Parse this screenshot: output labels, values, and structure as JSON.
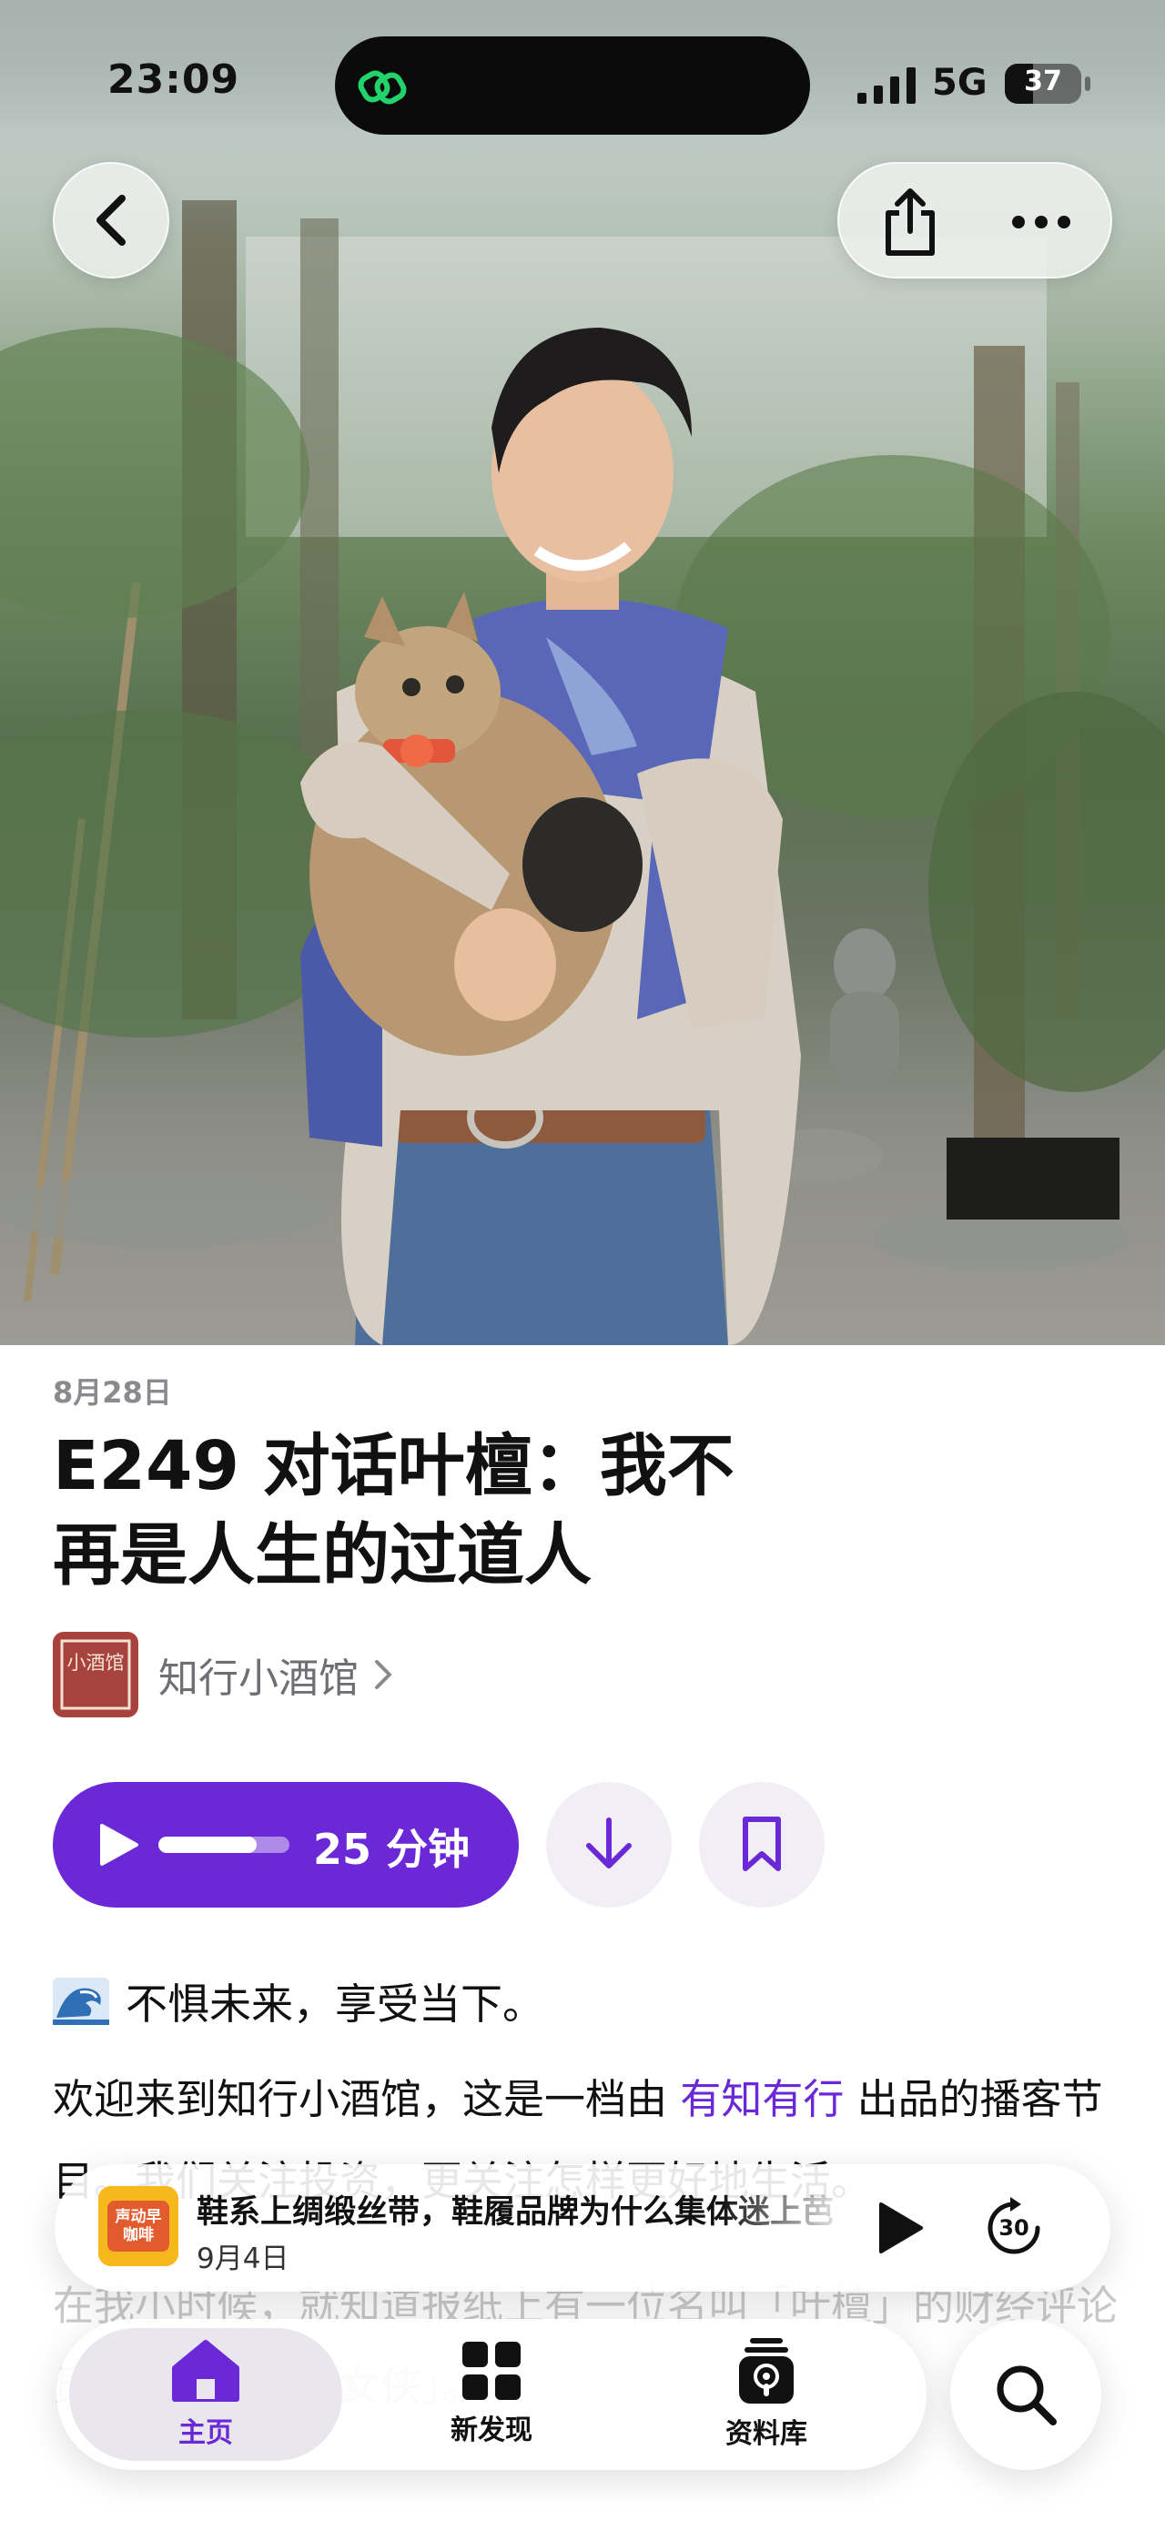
{
  "status_bar": {
    "time": "23:09",
    "network": "5G",
    "battery_percent": "37",
    "battery_level": 0.37
  },
  "colors": {
    "accent": "#6a28d6",
    "accent_light": "#f1eff5",
    "show_art": "#a8423c",
    "mini_art": "#f6b81c"
  },
  "icons": {
    "island": "link-icon",
    "back": "chevron-left-icon",
    "share": "share-icon",
    "more": "more-icon",
    "play": "play-icon",
    "download": "download-icon",
    "bookmark": "bookmark-icon",
    "wave": "wave-emoji-icon",
    "skip": "skip-forward-30-icon",
    "home": "home-icon",
    "discover": "grid-icon",
    "library": "podcast-library-icon",
    "search": "search-icon"
  },
  "episode": {
    "date": "8月28日",
    "title": "E249 对话叶檀：我不再是人生的过道人",
    "show_name": "知行小酒馆",
    "show_art_text": "小酒馆",
    "duration": "25 分钟",
    "progress": 0.75
  },
  "description": {
    "tagline": "不惧未来，享受当下。",
    "para1_before": "欢迎来到知行小酒馆，这是一档由 ",
    "para1_link": "有知有行",
    "para1_after": " 出品的播客节目。我们关注投资，更关注怎样更好地生活。",
    "faded": "在我小时候，就知道报纸上有一位名叫「叶檀」的财经评论员……为「财经女侠」。"
  },
  "mini_player": {
    "title": "鞋系上绸缎丝带，鞋履品牌为什么集体迷上芭",
    "date": "9月4日",
    "art_text": "声动早咖啡",
    "skip_seconds": "30"
  },
  "tabs": [
    {
      "label": "主页"
    },
    {
      "label": "新发现"
    },
    {
      "label": "资料库"
    }
  ]
}
